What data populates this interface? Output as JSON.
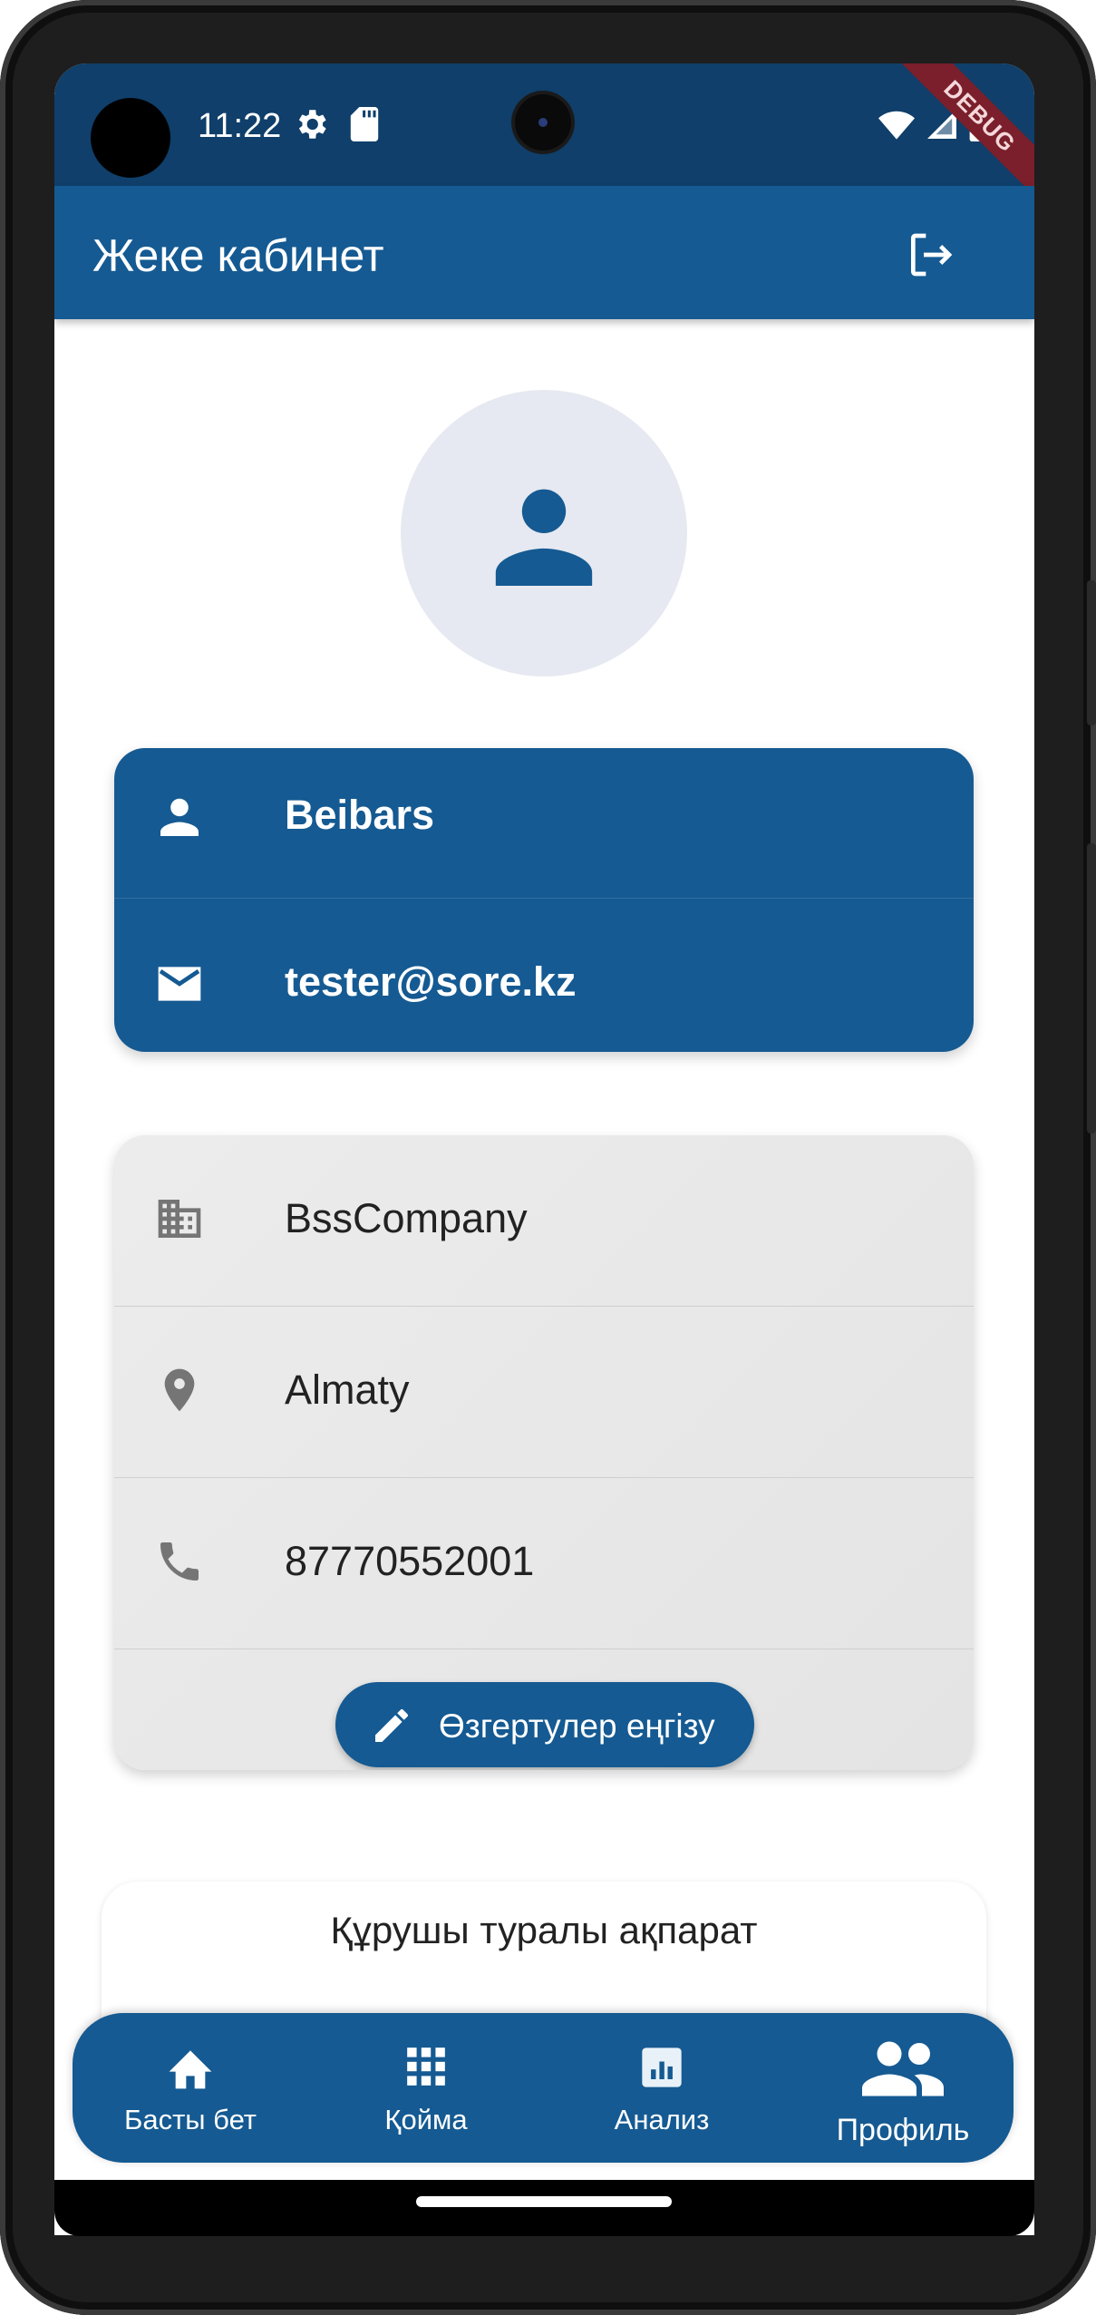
{
  "status_bar": {
    "time": "11:22",
    "debug_label": "DEBUG"
  },
  "app_bar": {
    "title": "Жеке кабинет"
  },
  "profile": {
    "name": "Beibars",
    "email": "tester@sore.kz",
    "company": "BssCompany",
    "city": "Almaty",
    "phone": "87770552001",
    "edit_button_label": "Өзгертулер еңгізу"
  },
  "builder_card": {
    "title": "Құрушы туралы ақпарат"
  },
  "bottom_nav": {
    "items": [
      {
        "label": "Басты бет",
        "icon": "home-icon"
      },
      {
        "label": "Қойма",
        "icon": "grid-icon"
      },
      {
        "label": "Анализ",
        "icon": "analytics-icon"
      },
      {
        "label": "Профиль",
        "icon": "people-icon",
        "selected": true
      }
    ]
  },
  "colors": {
    "primary": "#155a92",
    "status_bar": "#0f3f6a",
    "avatar_bg": "#e6e9f1",
    "card_gray": "#e8e8e8"
  }
}
